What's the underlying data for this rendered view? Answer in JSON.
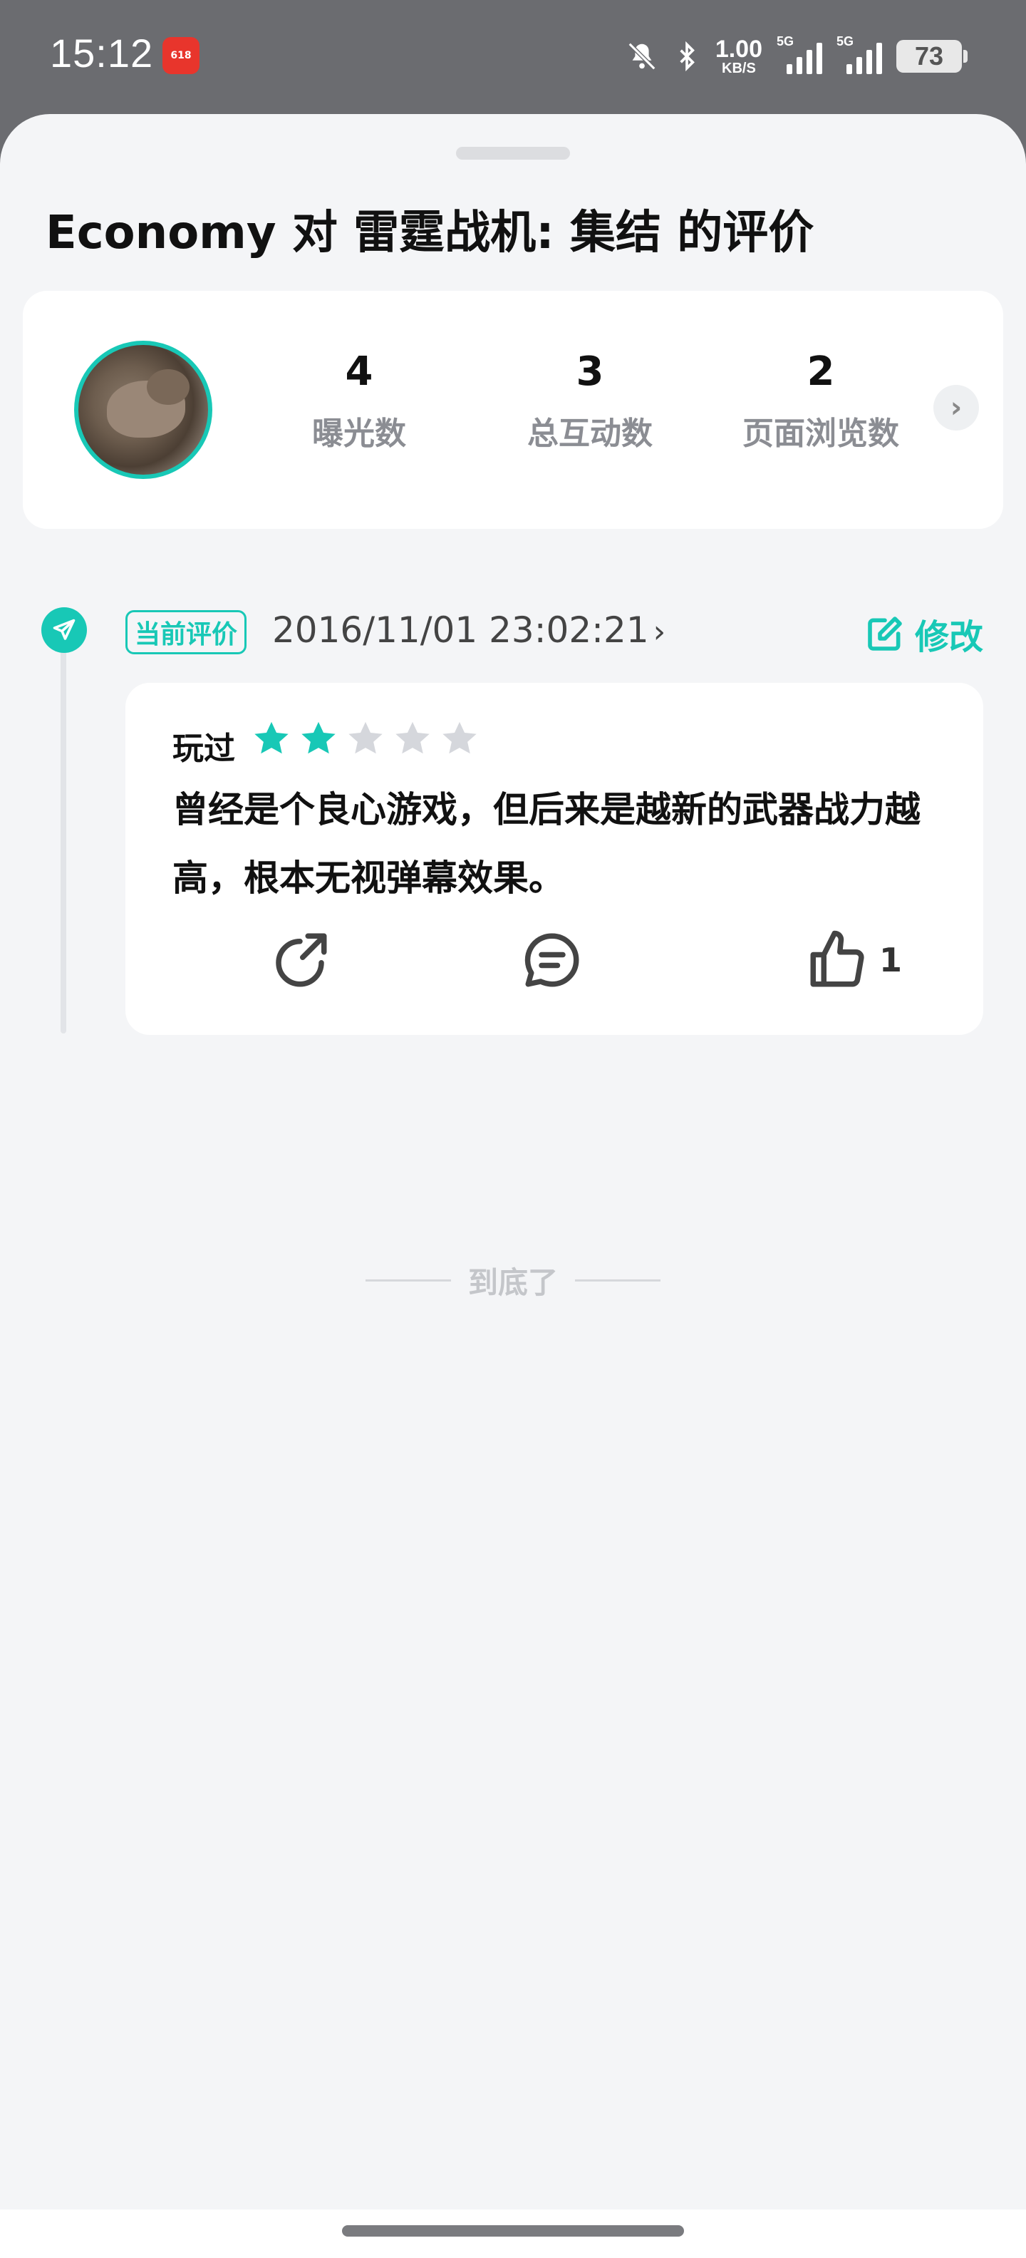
{
  "status_bar": {
    "time": "15:12",
    "app_badge": "618",
    "net_speed_value": "1.00",
    "net_speed_unit": "KB/S",
    "sim1": "5G",
    "sim2": "5G",
    "battery": "73"
  },
  "header": {
    "title": "Economy 对 雷霆战机: 集结 的评价"
  },
  "stats": {
    "items": [
      {
        "value": "4",
        "label": "曝光数"
      },
      {
        "value": "3",
        "label": "总互动数"
      },
      {
        "value": "2",
        "label": "页面浏览数"
      }
    ]
  },
  "review": {
    "tag": "当前评价",
    "datetime": "2016/11/01 23:02:21",
    "edit_label": "修改",
    "status": "玩过",
    "rating": 2,
    "rating_max": 5,
    "text": "曾经是个良心游戏，但后来是越新的武器战力越高，根本无视弹幕效果。",
    "likes": "1"
  },
  "footer": {
    "end_text": "到底了"
  },
  "colors": {
    "accent": "#18c8b6",
    "star_off": "#d5d7dc",
    "background": "#f4f5f7"
  }
}
